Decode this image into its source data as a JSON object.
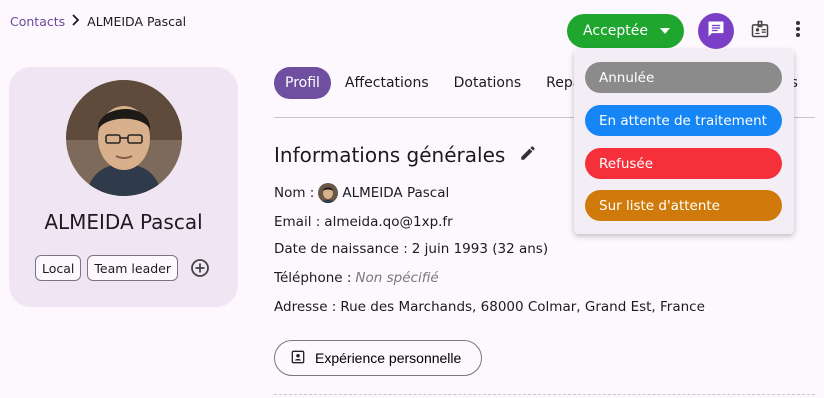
{
  "breadcrumb": {
    "parent": "Contacts",
    "separator": "›",
    "current": "ALMEIDA Pascal"
  },
  "header": {
    "status_label": "Acceptée",
    "status_color": "#1ea62f",
    "icons": [
      "chat-icon",
      "badge-icon",
      "more-vertical-icon"
    ]
  },
  "profile": {
    "name": "ALMEIDA Pascal",
    "tags": [
      "Local",
      "Team leader"
    ]
  },
  "tabs": [
    "Profil",
    "Affectations",
    "Dotations",
    "Repas",
    "es"
  ],
  "section": {
    "title": "Informations générales",
    "fields": {
      "name_label": "Nom :",
      "name_value": "ALMEIDA Pascal",
      "email_label": "Email :",
      "email_value": "almeida.qo@1xp.fr",
      "birth_label": "Date de naissance :",
      "birth_value": "2 juin 1993 (32 ans)",
      "phone_label": "Téléphone :",
      "phone_value": "Non spécifié",
      "address_label": "Adresse :",
      "address_value": "Rue des Marchands, 68000 Colmar, Grand Est, France"
    },
    "experience_button": "Expérience personnelle"
  },
  "status_menu": [
    {
      "label": "Annulée",
      "color": "#8b8b8b"
    },
    {
      "label": "En attente de traitement",
      "color": "#1685f5"
    },
    {
      "label": "Refusée",
      "color": "#f5303a"
    },
    {
      "label": "Sur liste d'attente",
      "color": "#d07a0c"
    }
  ]
}
